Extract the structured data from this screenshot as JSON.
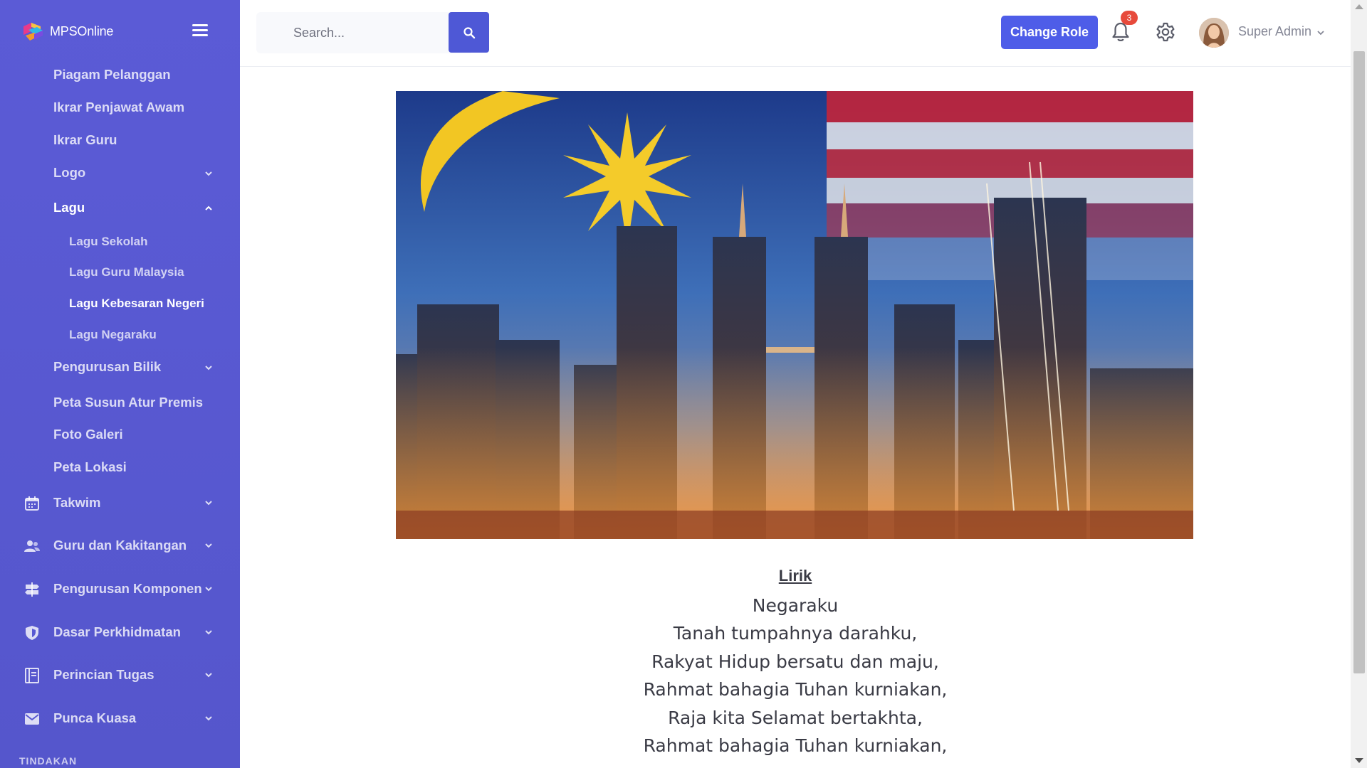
{
  "brand": {
    "name": "MPSOnline"
  },
  "sidebar": {
    "sub_items": [
      {
        "label": "Piagam Pelanggan"
      },
      {
        "label": "Ikrar Penjawat Awam"
      },
      {
        "label": "Ikrar Guru"
      },
      {
        "label": "Logo"
      },
      {
        "label": "Lagu"
      },
      {
        "label": "Pengurusan Bilik"
      },
      {
        "label": "Peta Susun Atur Premis"
      },
      {
        "label": "Foto Galeri"
      },
      {
        "label": "Peta Lokasi"
      }
    ],
    "lagu_children": [
      {
        "label": "Lagu Sekolah"
      },
      {
        "label": "Lagu Guru Malaysia"
      },
      {
        "label": "Lagu Kebesaran Negeri"
      },
      {
        "label": "Lagu Negaraku"
      }
    ],
    "main_items": [
      {
        "label": "Takwim",
        "icon": "calendar-icon"
      },
      {
        "label": "Guru dan Kakitangan",
        "icon": "users-icon"
      },
      {
        "label": "Pengurusan Komponen",
        "icon": "signpost-icon"
      },
      {
        "label": "Dasar Perkhidmatan",
        "icon": "shield-icon"
      },
      {
        "label": "Perincian Tugas",
        "icon": "book-icon"
      },
      {
        "label": "Punca Kuasa",
        "icon": "envelope-icon"
      }
    ],
    "section_heading": "TINDAKAN"
  },
  "topbar": {
    "search_placeholder": "Search...",
    "change_role_label": "Change Role",
    "notification_count": "3",
    "user_name": "Super Admin"
  },
  "content": {
    "lyrics_title": "Lirik",
    "lyrics": [
      "Negaraku",
      "Tanah tumpahnya darahku,",
      "Rakyat Hidup bersatu dan maju,",
      "Rahmat bahagia Tuhan kurniakan,",
      "Raja kita Selamat bertakhta,",
      "Rahmat bahagia Tuhan kurniakan,"
    ]
  },
  "colors": {
    "sidebar": "#5b5bd6",
    "primary_button": "#4e5de8",
    "badge": "#e74a3b"
  }
}
